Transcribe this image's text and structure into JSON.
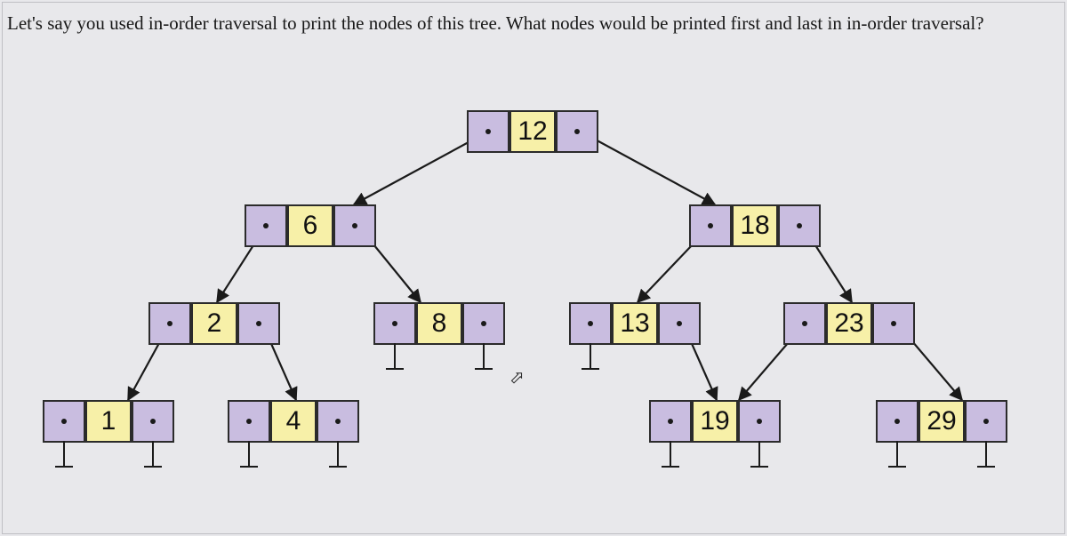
{
  "question": "Let's say you used in-order traversal to print the nodes of this tree. What nodes would be printed first and last in in-order traversal?",
  "tree": {
    "12": {
      "v": "12",
      "left": "6",
      "right": "18"
    },
    "6": {
      "v": "6",
      "left": "2",
      "right": "8"
    },
    "18": {
      "v": "18",
      "left": "13",
      "right": "23"
    },
    "2": {
      "v": "2",
      "left": "1",
      "right": "4"
    },
    "8": {
      "v": "8",
      "left": null,
      "right": null
    },
    "13": {
      "v": "13",
      "left": null,
      "right": "19"
    },
    "23": {
      "v": "23",
      "left": "19b",
      "right": "29"
    },
    "1": {
      "v": "1",
      "left": null,
      "right": null
    },
    "4": {
      "v": "4",
      "left": null,
      "right": null
    },
    "19": {
      "v": "19",
      "left": null,
      "right": null
    },
    "29": {
      "v": "29",
      "left": null,
      "right": null
    }
  },
  "colors": {
    "pointer": "#c9bde0",
    "value": "#f7f0a8",
    "line": "#1a1a1a"
  }
}
